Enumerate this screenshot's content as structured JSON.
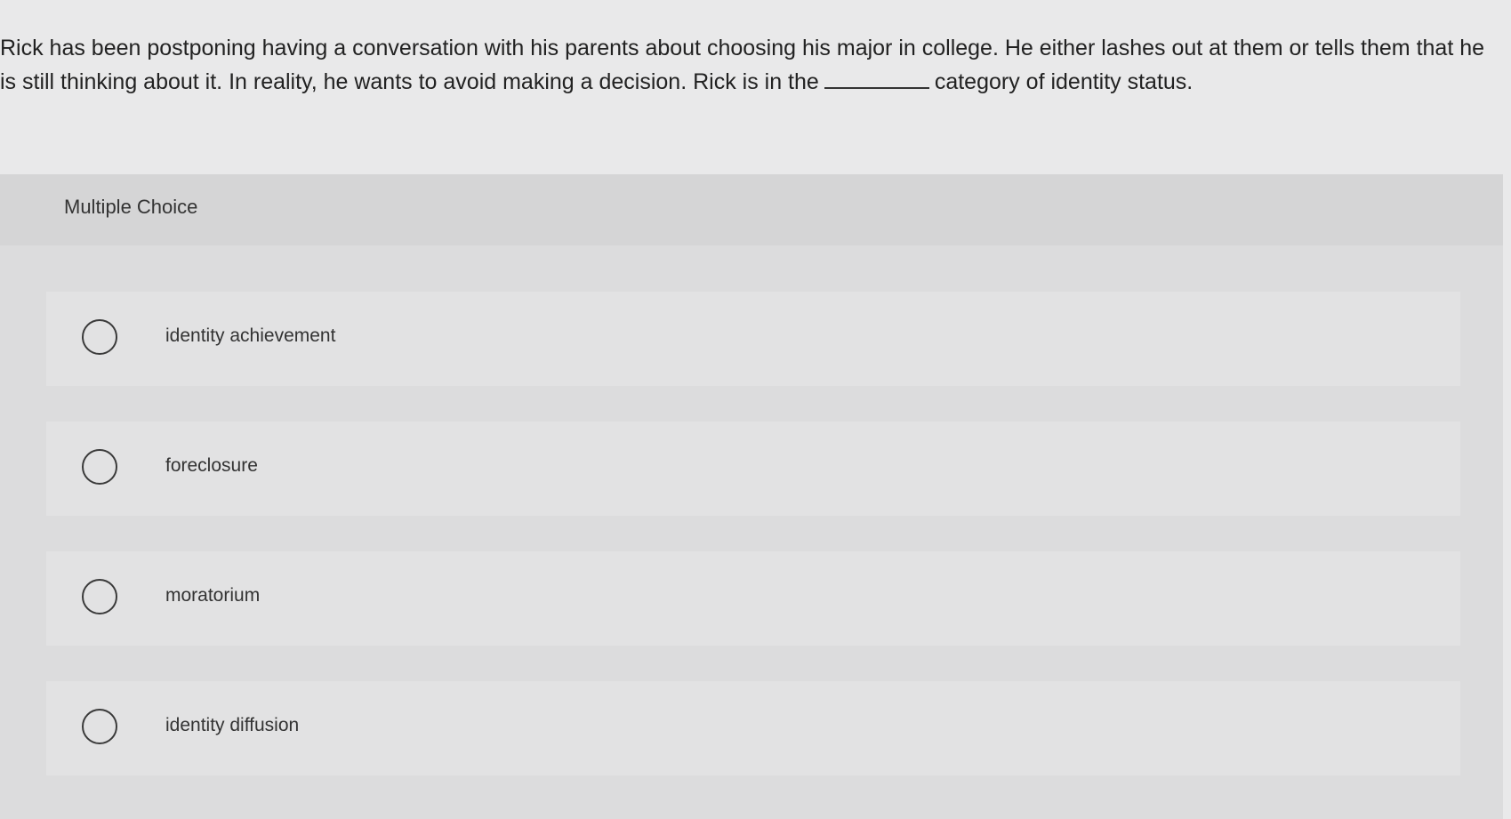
{
  "question": {
    "text_before": "Rick has been postponing having a conversation with his parents about choosing his major in college. He either lashes out at them or tells them that he is still thinking about it. In reality, he wants to avoid making a decision. Rick is in the",
    "text_after": "category of identity status."
  },
  "panel": {
    "title": "Multiple Choice"
  },
  "choices": [
    {
      "label": "identity achievement"
    },
    {
      "label": "foreclosure"
    },
    {
      "label": "moratorium"
    },
    {
      "label": "identity diffusion"
    }
  ],
  "icons": {
    "radio": "radio-unchecked-icon"
  },
  "colors": {
    "background": "#e9e9ea",
    "panel": "#dcdcdd",
    "text": "#222222"
  }
}
